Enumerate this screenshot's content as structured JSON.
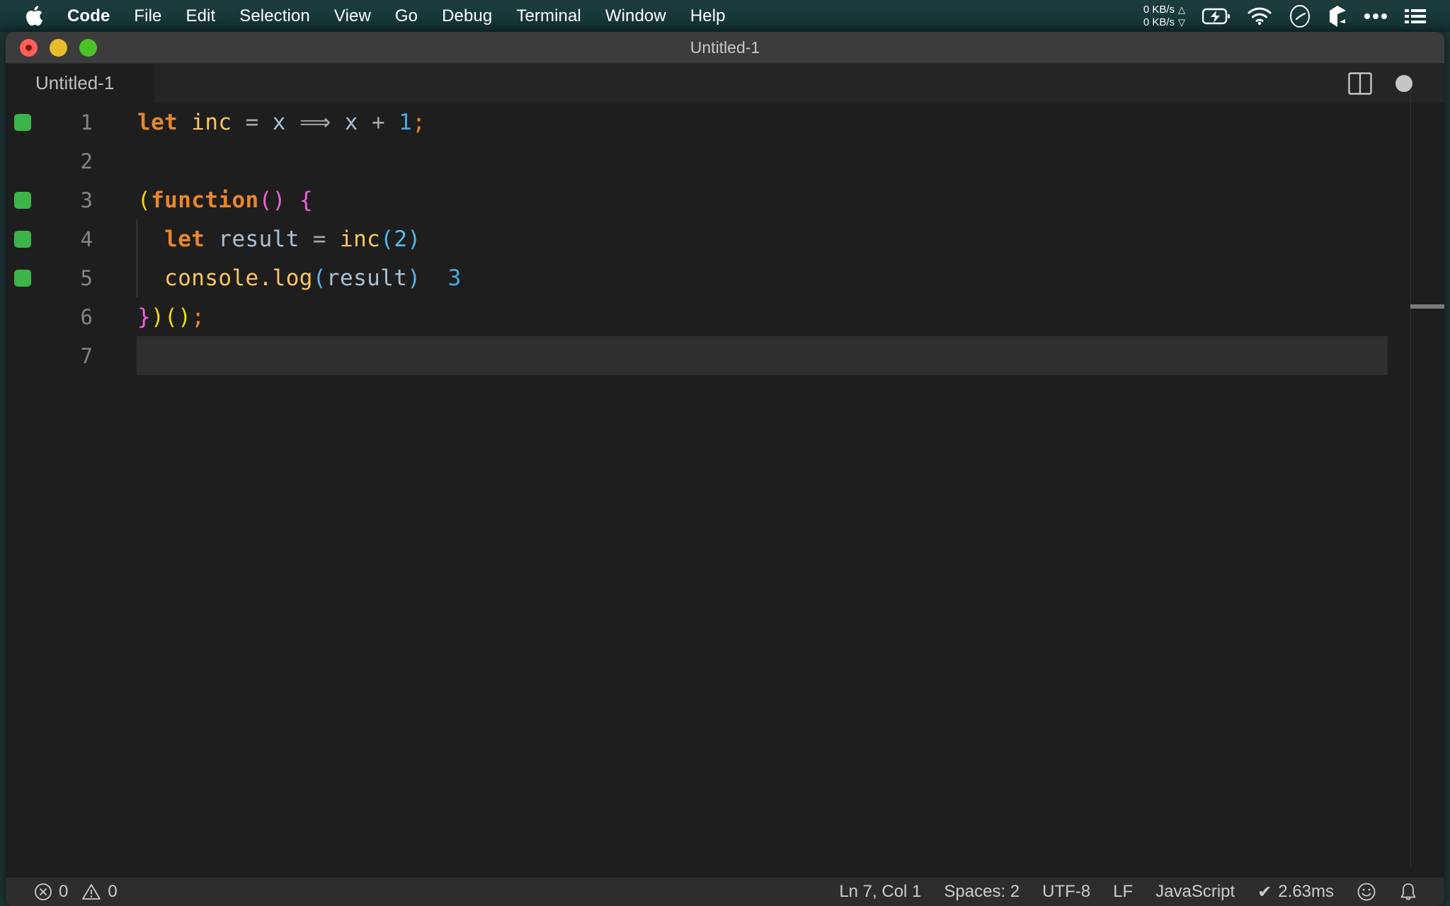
{
  "menubar": {
    "apple_icon": "apple-logo",
    "items": [
      {
        "label": "Code",
        "bold": true
      },
      {
        "label": "File",
        "bold": false
      },
      {
        "label": "Edit",
        "bold": false
      },
      {
        "label": "Selection",
        "bold": false
      },
      {
        "label": "View",
        "bold": false
      },
      {
        "label": "Go",
        "bold": false
      },
      {
        "label": "Debug",
        "bold": false
      },
      {
        "label": "Terminal",
        "bold": false
      },
      {
        "label": "Window",
        "bold": false
      },
      {
        "label": "Help",
        "bold": false
      }
    ],
    "network": {
      "upload": "0 KB/s",
      "download": "0 KB/s",
      "up_arrow": "△",
      "down_arrow": "▽"
    },
    "status_icons": [
      "battery-charging-icon",
      "wifi-icon",
      "clock-icon",
      "dropbox-icon",
      "ellipsis-icon",
      "control-center-icon"
    ],
    "background_color": "#17393a"
  },
  "window": {
    "title": "Untitled-1",
    "traffic_lights": [
      "close-button",
      "minimize-button",
      "maximize-button"
    ]
  },
  "tabbar": {
    "tabs": [
      {
        "label": "Untitled-1",
        "active": true
      }
    ],
    "actions": [
      "split-editor-icon",
      "unsaved-dot-indicator"
    ]
  },
  "editor": {
    "language": "JavaScript",
    "lines": [
      {
        "number": "1",
        "gutter_marker": true,
        "indent_guide": false,
        "current": false,
        "tokens": [
          {
            "text": "let",
            "cls": "t-kw"
          },
          {
            "text": " ",
            "cls": "t-plain"
          },
          {
            "text": "inc",
            "cls": "t-fn"
          },
          {
            "text": " ",
            "cls": "t-plain"
          },
          {
            "text": "=",
            "cls": "t-op"
          },
          {
            "text": " ",
            "cls": "t-plain"
          },
          {
            "text": "x",
            "cls": "t-var"
          },
          {
            "text": " ",
            "cls": "t-plain"
          },
          {
            "text": "⟹",
            "cls": "t-op"
          },
          {
            "text": " ",
            "cls": "t-plain"
          },
          {
            "text": "x",
            "cls": "t-var"
          },
          {
            "text": " ",
            "cls": "t-plain"
          },
          {
            "text": "+",
            "cls": "t-op"
          },
          {
            "text": " ",
            "cls": "t-plain"
          },
          {
            "text": "1",
            "cls": "t-num"
          },
          {
            "text": ";",
            "cls": "t-punc-o"
          }
        ]
      },
      {
        "number": "2",
        "gutter_marker": false,
        "indent_guide": false,
        "current": false,
        "tokens": []
      },
      {
        "number": "3",
        "gutter_marker": true,
        "indent_guide": false,
        "current": false,
        "tokens": [
          {
            "text": "(",
            "cls": "t-yellow"
          },
          {
            "text": "function",
            "cls": "t-kw"
          },
          {
            "text": "()",
            "cls": "t-magenta"
          },
          {
            "text": " ",
            "cls": "t-plain"
          },
          {
            "text": "{",
            "cls": "t-magenta"
          }
        ]
      },
      {
        "number": "4",
        "gutter_marker": true,
        "indent_guide": true,
        "current": false,
        "tokens": [
          {
            "text": "  ",
            "cls": "t-plain"
          },
          {
            "text": "let",
            "cls": "t-kw"
          },
          {
            "text": " ",
            "cls": "t-plain"
          },
          {
            "text": "result",
            "cls": "t-var"
          },
          {
            "text": " ",
            "cls": "t-plain"
          },
          {
            "text": "=",
            "cls": "t-op"
          },
          {
            "text": " ",
            "cls": "t-plain"
          },
          {
            "text": "inc",
            "cls": "t-fn"
          },
          {
            "text": "(",
            "cls": "t-blue"
          },
          {
            "text": "2",
            "cls": "t-blue"
          },
          {
            "text": ")",
            "cls": "t-blue"
          }
        ]
      },
      {
        "number": "5",
        "gutter_marker": true,
        "indent_guide": true,
        "current": false,
        "tokens": [
          {
            "text": "  ",
            "cls": "t-plain"
          },
          {
            "text": "console",
            "cls": "t-fn"
          },
          {
            "text": ".",
            "cls": "t-fn"
          },
          {
            "text": "log",
            "cls": "t-fn"
          },
          {
            "text": "(",
            "cls": "t-blue"
          },
          {
            "text": "result",
            "cls": "t-var"
          },
          {
            "text": ")",
            "cls": "t-blue"
          },
          {
            "text": "  ",
            "cls": "t-plain"
          },
          {
            "text": "3",
            "cls": "t-inline"
          }
        ]
      },
      {
        "number": "6",
        "gutter_marker": false,
        "indent_guide": false,
        "current": false,
        "tokens": [
          {
            "text": "}",
            "cls": "t-magenta"
          },
          {
            "text": ")",
            "cls": "t-yellow"
          },
          {
            "text": "(",
            "cls": "t-yellow"
          },
          {
            "text": ")",
            "cls": "t-yellow"
          },
          {
            "text": ";",
            "cls": "t-punc-o"
          }
        ]
      },
      {
        "number": "7",
        "gutter_marker": false,
        "indent_guide": false,
        "current": true,
        "tokens": []
      }
    ]
  },
  "statusbar": {
    "errors": {
      "icon": "error-circle-icon",
      "count": "0"
    },
    "warnings": {
      "icon": "warning-triangle-icon",
      "count": "0"
    },
    "position": "Ln 7, Col 1",
    "indentation": "Spaces: 2",
    "encoding": "UTF-8",
    "eol": "LF",
    "language": "JavaScript",
    "runtime": "2.63ms",
    "runtime_check": "✔",
    "feedback_icon": "smiley-icon",
    "notifications_icon": "bell-icon",
    "background_color": "#2d2d2d"
  },
  "colors": {
    "editor_bg": "#1e1e1e",
    "tabbar_bg": "#252526",
    "titlebar_bg": "#3c3c3c",
    "gutter_marker": "#3cb44a",
    "menubar_bg": "#17393a"
  }
}
